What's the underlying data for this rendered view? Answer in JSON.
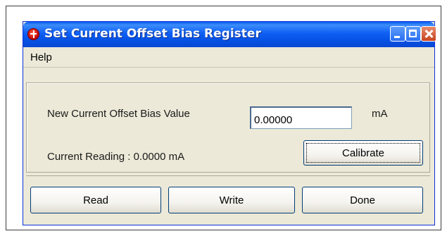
{
  "window": {
    "title": "Set Current Offset Bias Register"
  },
  "menu": {
    "items": [
      "Help"
    ]
  },
  "form": {
    "new_value_label": "New Current Offset Bias Value",
    "new_value": "0.00000",
    "unit": "mA",
    "current_reading_label": "Current Reading : 0.0000 mA"
  },
  "buttons": {
    "calibrate": "Calibrate",
    "read": "Read",
    "write": "Write",
    "done": "Done"
  },
  "icons": {
    "app": "target-crosshair-icon",
    "minimize": "minimize-icon",
    "maximize": "maximize-icon",
    "close": "close-icon"
  },
  "colors": {
    "titlebar": "#0a5bf0",
    "window_bg": "#ece9d8",
    "close_button": "#c8431e"
  }
}
